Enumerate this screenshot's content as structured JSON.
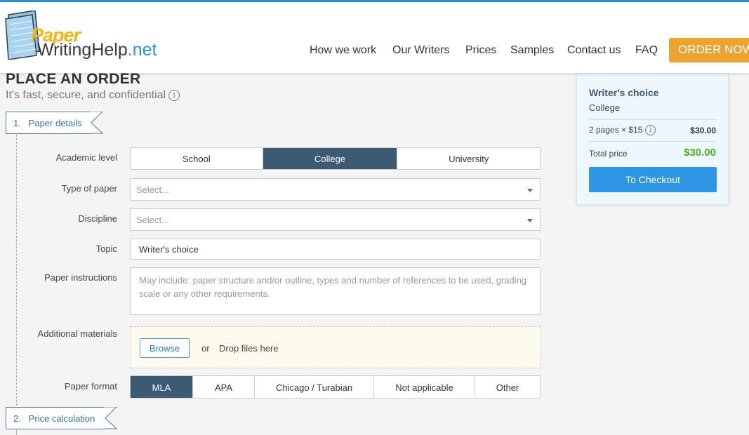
{
  "header": {
    "logo": {
      "line1": "Paper",
      "line2": "WritingHelp",
      "line3": ".net"
    },
    "nav": [
      {
        "label": "How we work"
      },
      {
        "label": "Our Writers"
      },
      {
        "label": "Prices"
      },
      {
        "label": "Samples"
      },
      {
        "label": "Contact us"
      },
      {
        "label": "FAQ"
      }
    ],
    "order_button": "ORDER NOW"
  },
  "page": {
    "title": "PLACE AN ORDER",
    "subtitle": "It's fast, secure, and confidential"
  },
  "steps": [
    {
      "label": "1.   Paper details"
    },
    {
      "label": "2.   Price calculation"
    }
  ],
  "form": {
    "academic_level": {
      "label": "Academic level",
      "options": [
        "School",
        "College",
        "University"
      ],
      "selected": "College"
    },
    "type_of_paper": {
      "label": "Type of paper",
      "placeholder": "Select..."
    },
    "discipline": {
      "label": "Discipline",
      "placeholder": "Select..."
    },
    "topic": {
      "label": "Topic",
      "value": "Writer's choice"
    },
    "instructions": {
      "label": "Paper instructions",
      "placeholder": "May include: paper structure and/or outline, types and number of references to be used, grading scale or any other requirements."
    },
    "materials": {
      "label": "Additional materials",
      "browse": "Browse",
      "or": "or",
      "drop": "Drop files here"
    },
    "paper_format": {
      "label": "Paper format",
      "options": [
        "MLA",
        "APA",
        "Chicago / Turabian",
        "Not applicable",
        "Other"
      ],
      "selected": "MLA"
    }
  },
  "summary": {
    "title": "Writer's choice",
    "level": "College",
    "pages": "2 pages × $15",
    "pages_price": "$30.00",
    "total_label": "Total price",
    "total": "$30.00",
    "checkout": "To Checkout"
  },
  "colors": {
    "accent_blue": "#2d8fd9",
    "active_segment": "#3d5a73",
    "order_button": "#eba431",
    "total_green": "#4cae23"
  }
}
